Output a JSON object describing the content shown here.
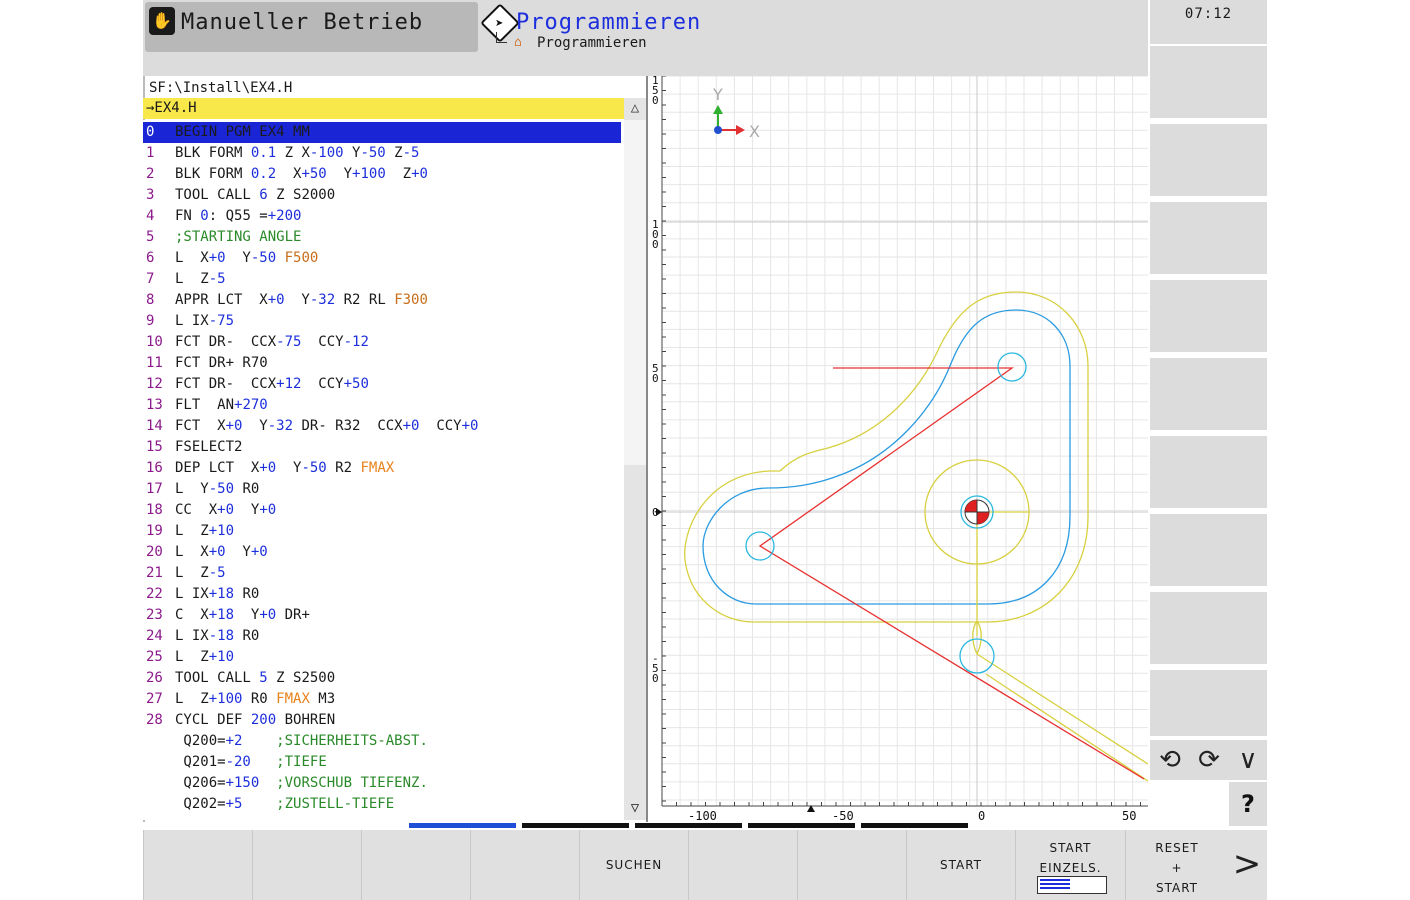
{
  "header": {
    "mode_manual": "Manueller Betrieb",
    "mode_prog": "Programmieren",
    "mode_prog_sub": "Programmieren"
  },
  "clock": "07:12",
  "program": {
    "path": "SF:\\Install\\EX4.H",
    "file": "→EX4.H",
    "lines": [
      {
        "num": "0",
        "parts": [
          [
            "c",
            "BEGIN PGM EX4 MM"
          ]
        ],
        "selected": true
      },
      {
        "num": "1",
        "parts": [
          [
            "c",
            "BLK FORM "
          ],
          [
            "v",
            "0.1"
          ],
          [
            "c",
            " Z X"
          ],
          [
            "v",
            "-100"
          ],
          [
            "c",
            " Y"
          ],
          [
            "v",
            "-50"
          ],
          [
            "c",
            " Z"
          ],
          [
            "v",
            "-5"
          ]
        ]
      },
      {
        "num": "2",
        "parts": [
          [
            "c",
            "BLK FORM "
          ],
          [
            "v",
            "0.2"
          ],
          [
            "c",
            "  X"
          ],
          [
            "v",
            "+50"
          ],
          [
            "c",
            "  Y"
          ],
          [
            "v",
            "+100"
          ],
          [
            "c",
            "  Z"
          ],
          [
            "v",
            "+0"
          ]
        ]
      },
      {
        "num": "3",
        "parts": [
          [
            "c",
            "TOOL CALL "
          ],
          [
            "v",
            "6"
          ],
          [
            "c",
            " Z S2000"
          ]
        ]
      },
      {
        "num": "4",
        "parts": [
          [
            "c",
            "FN "
          ],
          [
            "v",
            "0"
          ],
          [
            "c",
            ": Q55 ="
          ],
          [
            "v",
            "+200"
          ]
        ]
      },
      {
        "num": "5",
        "parts": [
          [
            "cm",
            ";STARTING ANGLE"
          ]
        ]
      },
      {
        "num": "6",
        "parts": [
          [
            "c",
            "L  X"
          ],
          [
            "v",
            "+0"
          ],
          [
            "c",
            "  Y"
          ],
          [
            "v",
            "-50"
          ],
          [
            "c",
            " "
          ],
          [
            "f",
            "F500"
          ]
        ]
      },
      {
        "num": "7",
        "parts": [
          [
            "c",
            "L  Z"
          ],
          [
            "v",
            "-5"
          ]
        ]
      },
      {
        "num": "8",
        "parts": [
          [
            "c",
            "APPR LCT  X"
          ],
          [
            "v",
            "+0"
          ],
          [
            "c",
            "  Y"
          ],
          [
            "v",
            "-32"
          ],
          [
            "c",
            " R2 RL "
          ],
          [
            "f",
            "F300"
          ]
        ]
      },
      {
        "num": "9",
        "parts": [
          [
            "c",
            "L IX"
          ],
          [
            "v",
            "-75"
          ]
        ]
      },
      {
        "num": "10",
        "parts": [
          [
            "c",
            "FCT DR-  CCX"
          ],
          [
            "v",
            "-75"
          ],
          [
            "c",
            "  CCY"
          ],
          [
            "v",
            "-12"
          ]
        ]
      },
      {
        "num": "11",
        "parts": [
          [
            "c",
            "FCT DR+ R70"
          ]
        ]
      },
      {
        "num": "12",
        "parts": [
          [
            "c",
            "FCT DR-  CCX"
          ],
          [
            "v",
            "+12"
          ],
          [
            "c",
            "  CCY"
          ],
          [
            "v",
            "+50"
          ]
        ]
      },
      {
        "num": "13",
        "parts": [
          [
            "c",
            "FLT  AN"
          ],
          [
            "v",
            "+270"
          ]
        ]
      },
      {
        "num": "14",
        "parts": [
          [
            "c",
            "FCT  X"
          ],
          [
            "v",
            "+0"
          ],
          [
            "c",
            "  Y"
          ],
          [
            "v",
            "-32"
          ],
          [
            "c",
            " DR- R32  CCX"
          ],
          [
            "v",
            "+0"
          ],
          [
            "c",
            "  CCY"
          ],
          [
            "v",
            "+0"
          ]
        ]
      },
      {
        "num": "15",
        "parts": [
          [
            "c",
            "FSELECT2"
          ]
        ]
      },
      {
        "num": "16",
        "parts": [
          [
            "c",
            "DEP LCT  X"
          ],
          [
            "v",
            "+0"
          ],
          [
            "c",
            "  Y"
          ],
          [
            "v",
            "-50"
          ],
          [
            "c",
            " R2 "
          ],
          [
            "fm",
            "FMAX"
          ]
        ]
      },
      {
        "num": "17",
        "parts": [
          [
            "c",
            "L  Y"
          ],
          [
            "v",
            "-50"
          ],
          [
            "c",
            " R0"
          ]
        ]
      },
      {
        "num": "18",
        "parts": [
          [
            "c",
            "CC  X"
          ],
          [
            "v",
            "+0"
          ],
          [
            "c",
            "  Y"
          ],
          [
            "v",
            "+0"
          ]
        ]
      },
      {
        "num": "19",
        "parts": [
          [
            "c",
            "L  Z"
          ],
          [
            "v",
            "+10"
          ]
        ]
      },
      {
        "num": "20",
        "parts": [
          [
            "c",
            "L  X"
          ],
          [
            "v",
            "+0"
          ],
          [
            "c",
            "  Y"
          ],
          [
            "v",
            "+0"
          ]
        ]
      },
      {
        "num": "21",
        "parts": [
          [
            "c",
            "L  Z"
          ],
          [
            "v",
            "-5"
          ]
        ]
      },
      {
        "num": "22",
        "parts": [
          [
            "c",
            "L IX"
          ],
          [
            "v",
            "+18"
          ],
          [
            "c",
            " R0"
          ]
        ]
      },
      {
        "num": "23",
        "parts": [
          [
            "c",
            "C  X"
          ],
          [
            "v",
            "+18"
          ],
          [
            "c",
            "  Y"
          ],
          [
            "v",
            "+0"
          ],
          [
            "c",
            " DR+"
          ]
        ]
      },
      {
        "num": "24",
        "parts": [
          [
            "c",
            "L IX"
          ],
          [
            "v",
            "-18"
          ],
          [
            "c",
            " R0"
          ]
        ]
      },
      {
        "num": "25",
        "parts": [
          [
            "c",
            "L  Z"
          ],
          [
            "v",
            "+10"
          ]
        ]
      },
      {
        "num": "26",
        "parts": [
          [
            "c",
            "TOOL CALL "
          ],
          [
            "v",
            "5"
          ],
          [
            "c",
            " Z S2500"
          ]
        ]
      },
      {
        "num": "27",
        "parts": [
          [
            "c",
            "L  Z"
          ],
          [
            "v",
            "+100"
          ],
          [
            "c",
            " R0 "
          ],
          [
            "fm",
            "FMAX"
          ],
          [
            "c",
            " M3"
          ]
        ]
      },
      {
        "num": "28",
        "parts": [
          [
            "c",
            "CYCL DEF "
          ],
          [
            "v",
            "200"
          ],
          [
            "c",
            " BOHREN"
          ]
        ]
      },
      {
        "num": "",
        "parts": [
          [
            "c",
            " Q200="
          ],
          [
            "v",
            "+2"
          ],
          [
            "c",
            "    "
          ],
          [
            "cm",
            ";SICHERHEITS-ABST."
          ]
        ]
      },
      {
        "num": "",
        "parts": [
          [
            "c",
            " Q201="
          ],
          [
            "v",
            "-20"
          ],
          [
            "c",
            "   "
          ],
          [
            "cm",
            ";TIEFE"
          ]
        ]
      },
      {
        "num": "",
        "parts": [
          [
            "c",
            " Q206="
          ],
          [
            "v",
            "+150"
          ],
          [
            "c",
            "  "
          ],
          [
            "cm",
            ";VORSCHUB TIEFENZ."
          ]
        ]
      },
      {
        "num": "",
        "parts": [
          [
            "c",
            " Q202="
          ],
          [
            "v",
            "+5"
          ],
          [
            "c",
            "    "
          ],
          [
            "cm",
            ";ZUSTELL-TIEFE"
          ]
        ]
      }
    ]
  },
  "graphic": {
    "axis_x": "X",
    "axis_y": "Y",
    "ruler_y": [
      "150",
      "100",
      "50",
      "0",
      "-50"
    ],
    "ruler_x": [
      "-100",
      "-50",
      "0",
      "50"
    ],
    "colors": {
      "tool_path": "#e83030",
      "contour": "#2a9be0",
      "offset": "#d8d040"
    }
  },
  "softkeys": {
    "suchen": "SUCHEN",
    "start": "START",
    "start_einzels": [
      "START",
      "EINZELS."
    ],
    "reset_start": [
      "RESET",
      "+",
      "START"
    ],
    "next": ">"
  },
  "side": {
    "help": "?",
    "view_icons": [
      "rotate-left-icon",
      "rotate-right-icon",
      "chevron-down-icon"
    ]
  }
}
